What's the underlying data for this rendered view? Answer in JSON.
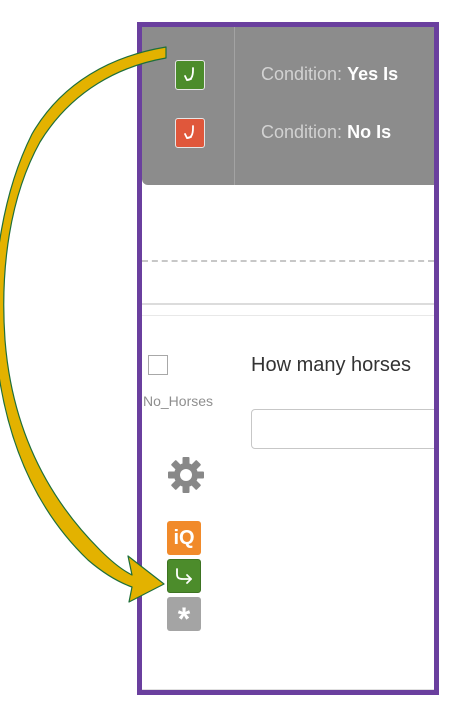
{
  "conditions": [
    {
      "label": "Condition:",
      "value": "Yes Is",
      "color": "#4c8c2b",
      "icon": "arrow-return-icon"
    },
    {
      "label": "Condition:",
      "value": "No Is",
      "color": "#e0573b",
      "icon": "arrow-return-icon"
    }
  ],
  "question": {
    "id": "No_Horses",
    "text": "How many horses",
    "input_value": ""
  },
  "tools": {
    "settings_icon": "gear-icon",
    "iq_label": "iQ",
    "logic_icon": "display-logic-icon",
    "required_label": "*"
  },
  "colors": {
    "frame": "#6a3f9e",
    "arrow_fill": "#e3b200",
    "arrow_stroke": "#1f6f3b",
    "panel": "#8c8c8c"
  }
}
